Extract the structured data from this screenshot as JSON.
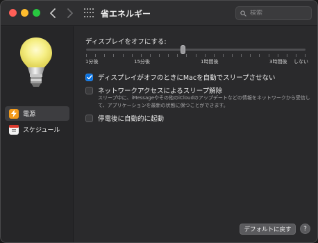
{
  "window": {
    "title": "省エネルギー"
  },
  "search": {
    "placeholder": "検索"
  },
  "sidebar": {
    "items": [
      {
        "label": "電源",
        "icon": "bolt-icon",
        "color": "#f29a1a"
      },
      {
        "label": "スケジュール",
        "icon": "calendar-icon",
        "color": "#d93a2f"
      }
    ]
  },
  "display_sleep": {
    "label": "ディスプレイをオフにする:",
    "ticks": [
      "1分後",
      "15分後",
      "1時間後",
      "3時間後",
      "しない"
    ],
    "value_fraction": 0.44
  },
  "options": [
    {
      "label": "ディスプレイがオフのときにMacを自動でスリープさせない",
      "checked": true
    },
    {
      "label": "ネットワークアクセスによるスリープ解除",
      "checked": false
    },
    {
      "label": "停電後に自動的に起動",
      "checked": false
    }
  ],
  "network_description": "スリープ中に、iMessageやその他のiCloudのアップデートなどの情報をネットワークから受信して、アプリケーションを最新の状態に保つことができます。",
  "footer": {
    "restore_defaults_label": "デフォルトに戻す",
    "help_label": "?"
  },
  "colors": {
    "accent": "#0a72e0",
    "close": "#ff5f57",
    "minimize": "#febc2e",
    "maximize": "#28c840"
  }
}
